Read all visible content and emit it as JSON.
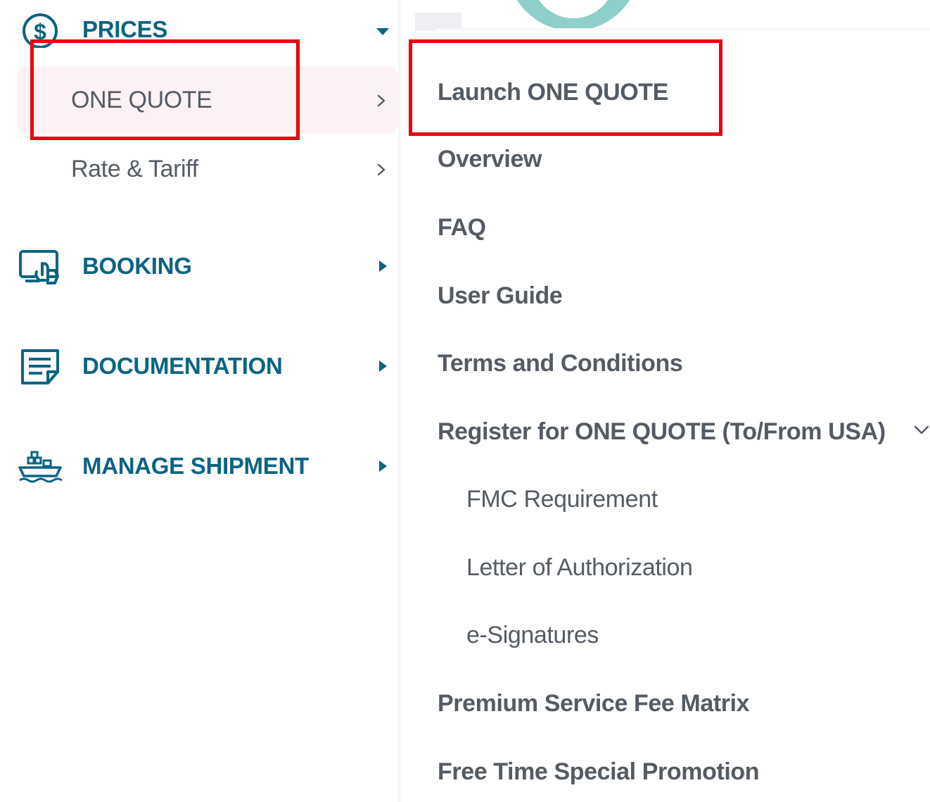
{
  "left_menu": {
    "prices": {
      "label": "PRICES",
      "icon": "dollar-circle-icon",
      "expanded": true
    },
    "prices_items": [
      {
        "label": "ONE QUOTE",
        "active": true
      },
      {
        "label": "Rate & Tariff",
        "active": false
      }
    ],
    "booking": {
      "label": "BOOKING",
      "icon": "booking-hand-icon"
    },
    "documentation": {
      "label": "DOCUMENTATION",
      "icon": "document-icon"
    },
    "manage_shipment": {
      "label": "MANAGE SHIPMENT",
      "icon": "ship-icon"
    }
  },
  "submenu": {
    "items": [
      "Launch ONE QUOTE",
      "Overview",
      "FAQ",
      "User Guide",
      "Terms and Conditions",
      "Register for ONE QUOTE (To/From USA)"
    ],
    "register_subitems": [
      "FMC Requirement",
      "Letter of Authorization",
      "e-Signatures"
    ],
    "bottom_items": [
      "Premium Service Fee Matrix",
      "Free Time Special Promotion"
    ]
  },
  "colors": {
    "nav_blue": "#0c6384",
    "text_gray": "#545b63",
    "active_bg": "#fcf1f4",
    "highlight_red": "#e8000f"
  }
}
